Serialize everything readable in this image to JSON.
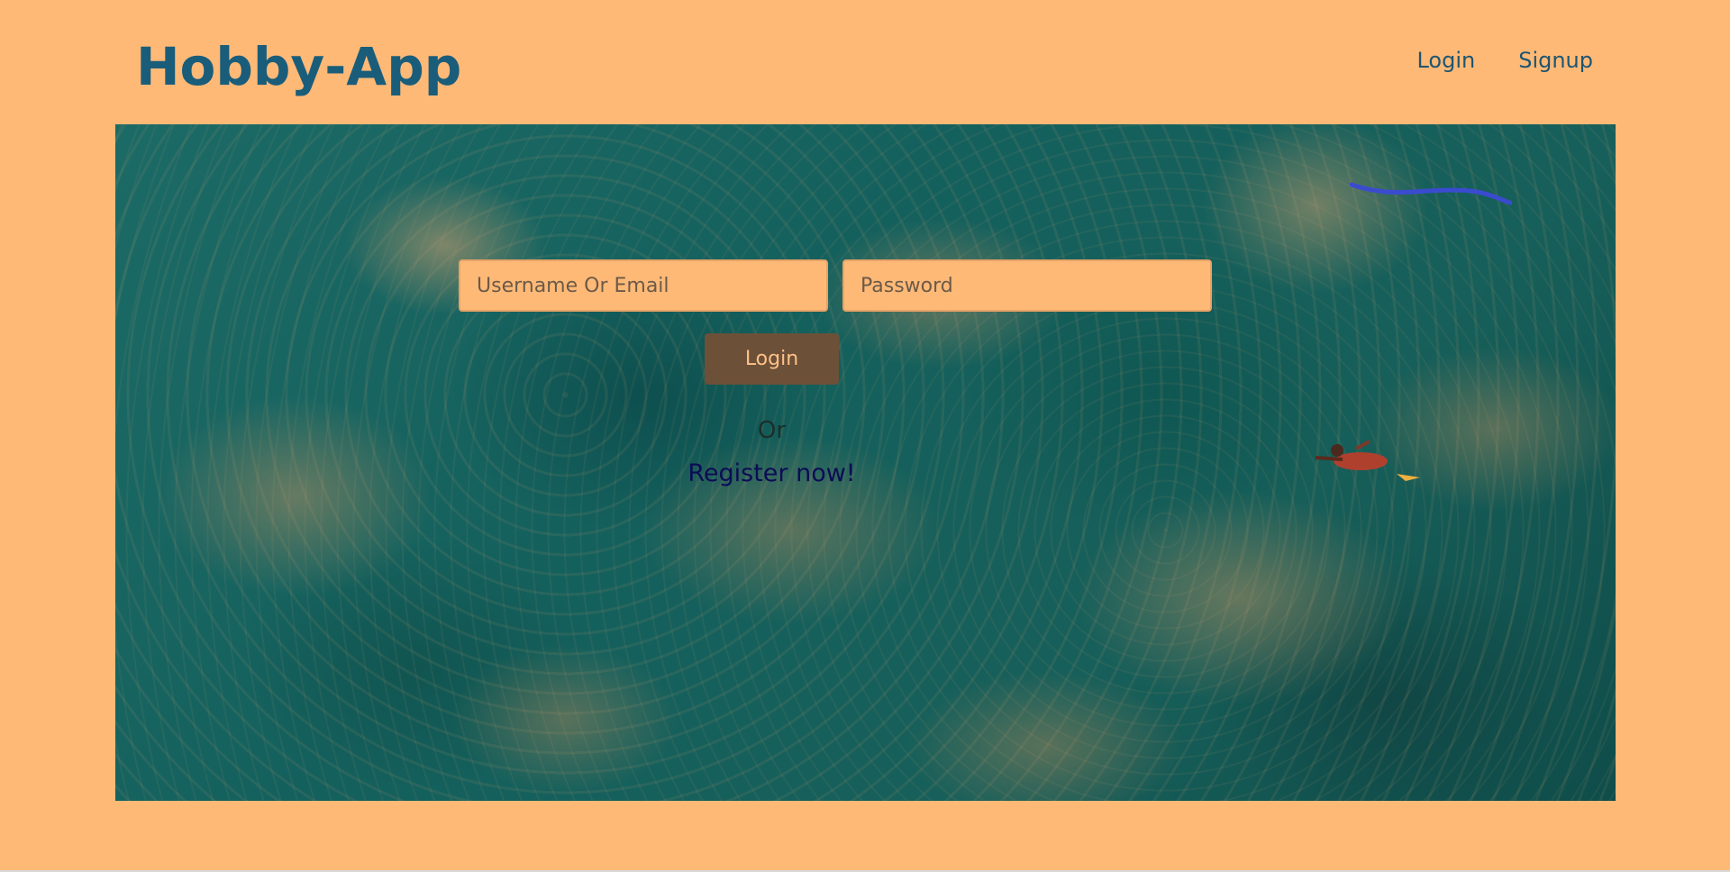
{
  "header": {
    "brand": "Hobby-App",
    "nav": [
      {
        "label": "Login"
      },
      {
        "label": "Signup"
      }
    ]
  },
  "login_form": {
    "username_placeholder": "Username Or Email",
    "password_placeholder": "Password",
    "username_value": "",
    "password_value": "",
    "submit_label": "Login",
    "or_text": "Or",
    "register_label": "Register now!"
  },
  "colors": {
    "background": "#ffb977",
    "brand": "#1a5d7a",
    "button": "#6c5038",
    "register_link": "#0c0c55"
  }
}
